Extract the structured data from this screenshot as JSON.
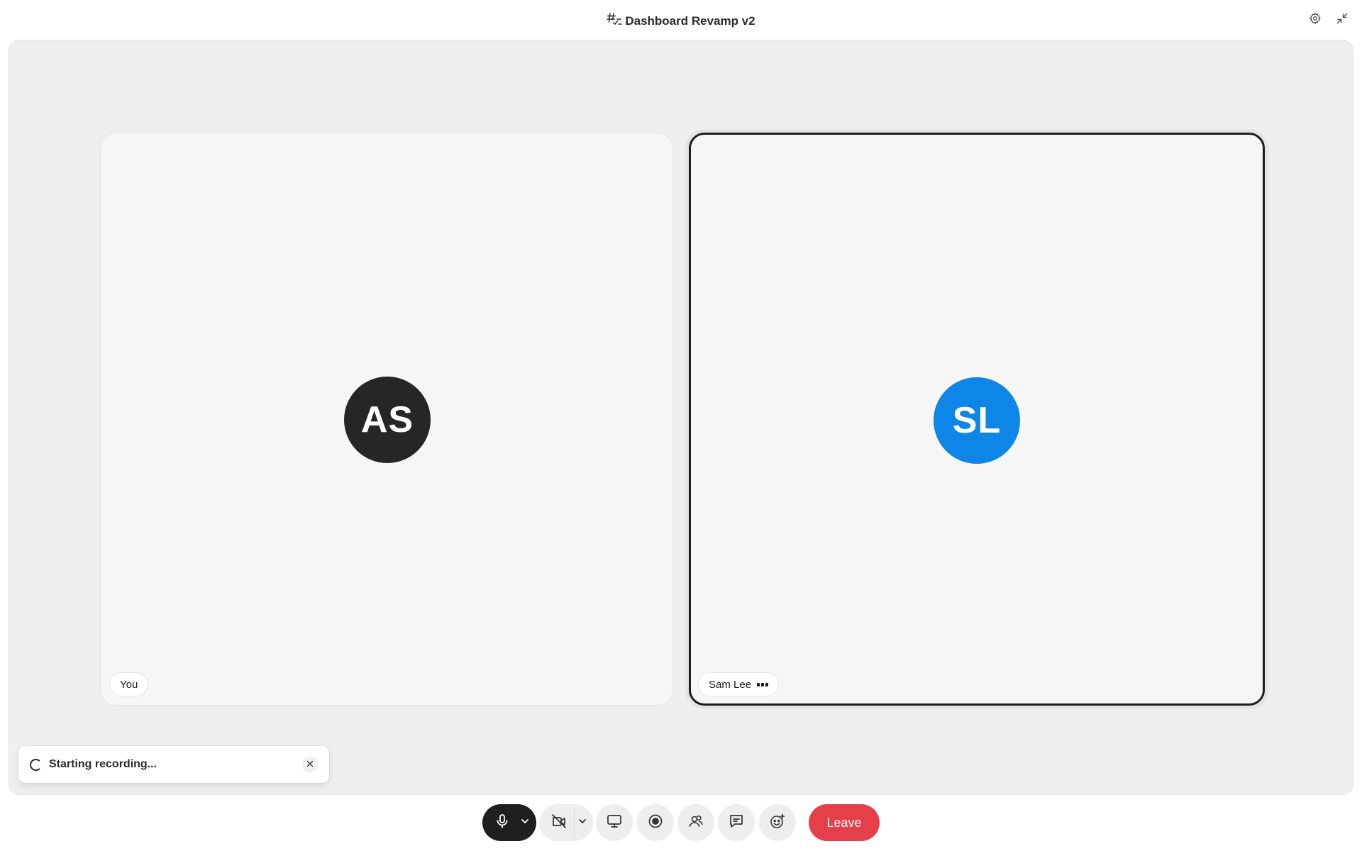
{
  "titlebar": {
    "title": "Dashboard Revamp v2",
    "title_icon": "huddle-channel-icon",
    "settings_icon": "gear-icon",
    "shrink_icon": "minimize-arrows-icon"
  },
  "participants": [
    {
      "initials": "AS",
      "name": "You",
      "avatar_color": "#262626",
      "active_speaker": false
    },
    {
      "initials": "SL",
      "name": "Sam Lee",
      "avatar_color": "#0d86e8",
      "active_speaker": true,
      "status_icon": "more-dots-icon"
    }
  ],
  "toast": {
    "message": "Starting recording...",
    "spinner_icon": "loading-spinner-icon",
    "close_icon": "close-icon"
  },
  "controls": {
    "mic_icon": "microphone-icon",
    "camera_icon": "camera-off-icon",
    "share_icon": "screen-share-icon",
    "record_icon": "record-icon",
    "people_icon": "add-people-icon",
    "chat_icon": "chat-icon",
    "reaction_icon": "emoji-reaction-icon",
    "leave_label": "Leave",
    "leave_color": "#e5404a"
  }
}
